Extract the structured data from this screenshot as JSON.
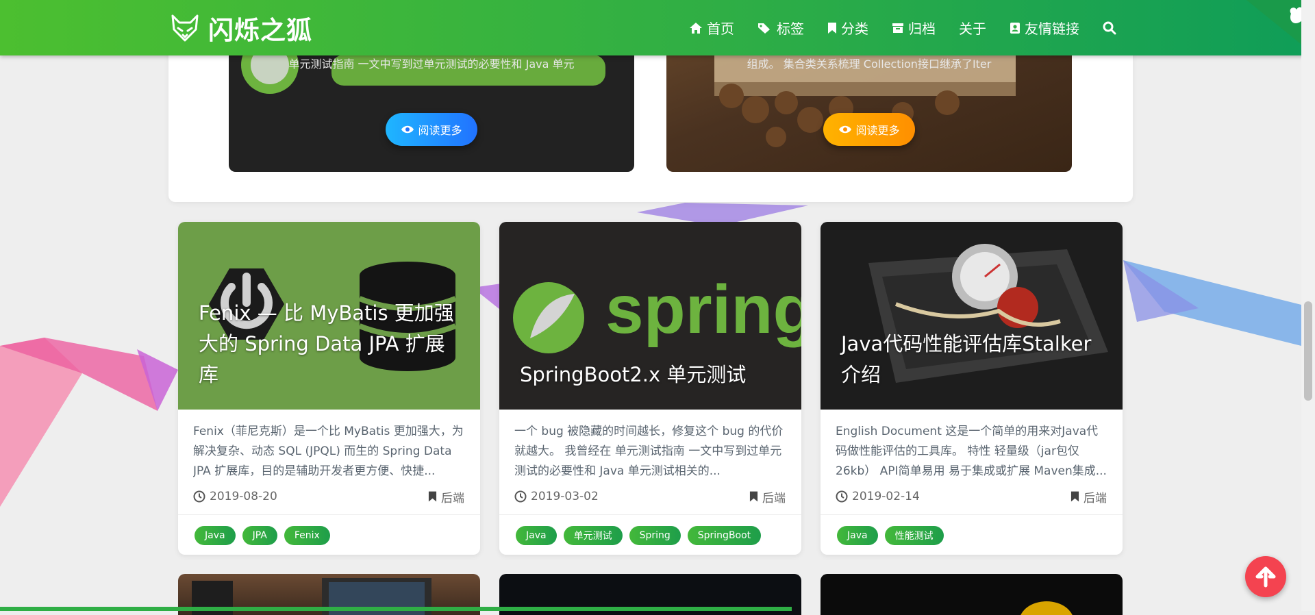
{
  "header": {
    "site_title": "闪烁之狐",
    "nav": [
      {
        "label": "首页",
        "icon": "home-icon"
      },
      {
        "label": "标签",
        "icon": "tags-icon"
      },
      {
        "label": "分类",
        "icon": "bookmark-icon"
      },
      {
        "label": "归档",
        "icon": "archive-icon"
      },
      {
        "label": "关于",
        "icon": ""
      },
      {
        "label": "友情链接",
        "icon": "address-book-icon"
      }
    ],
    "search_icon": "search-icon"
  },
  "featured": [
    {
      "excerpt": "单元测试指南 一文中写到过单元测试的必要性和 Java 单元",
      "read_more": "阅读更多",
      "button_color": "#2172ff"
    },
    {
      "excerpt": "组成。 集合类关系梳理 Collection接口继承了Iter",
      "read_more": "阅读更多",
      "button_color": "#ffa000"
    }
  ],
  "articles": [
    {
      "title": "Fenix — 比 MyBatis 更加强大的 Spring Data JPA 扩展库",
      "summary": "Fenix（菲尼克斯）是一个比 MyBatis 更加强大，为解决复杂、动态 SQL (JPQL) 而生的 Spring Data JPA 扩展库，目的是辅助开发者更方便、快捷...",
      "date": "2019-08-20",
      "category": "后端",
      "tags": [
        "Java",
        "JPA",
        "Fenix"
      ]
    },
    {
      "title": "SpringBoot2.x 单元测试",
      "summary": "一个 bug 被隐藏的时间越长，修复这个 bug 的代价就越大。 我曾经在 单元测试指南 一文中写到过单元测试的必要性和 Java 单元测试相关的...",
      "date": "2019-03-02",
      "category": "后端",
      "tags": [
        "Java",
        "单元测试",
        "Spring",
        "SpringBoot"
      ]
    },
    {
      "title": "Java代码性能评估库Stalker介绍",
      "summary": "English Document 这是一个简单的用来对Java代码做性能评估的工具库。 特性 轻量级（jar包仅26kb） API简单易用 易于集成或扩展 Maven集成...",
      "date": "2019-02-14",
      "category": "后端",
      "tags": [
        "Java",
        "性能测试"
      ]
    }
  ],
  "colors": {
    "brand_green": "#2fae45",
    "back_to_top": "#f44350"
  }
}
